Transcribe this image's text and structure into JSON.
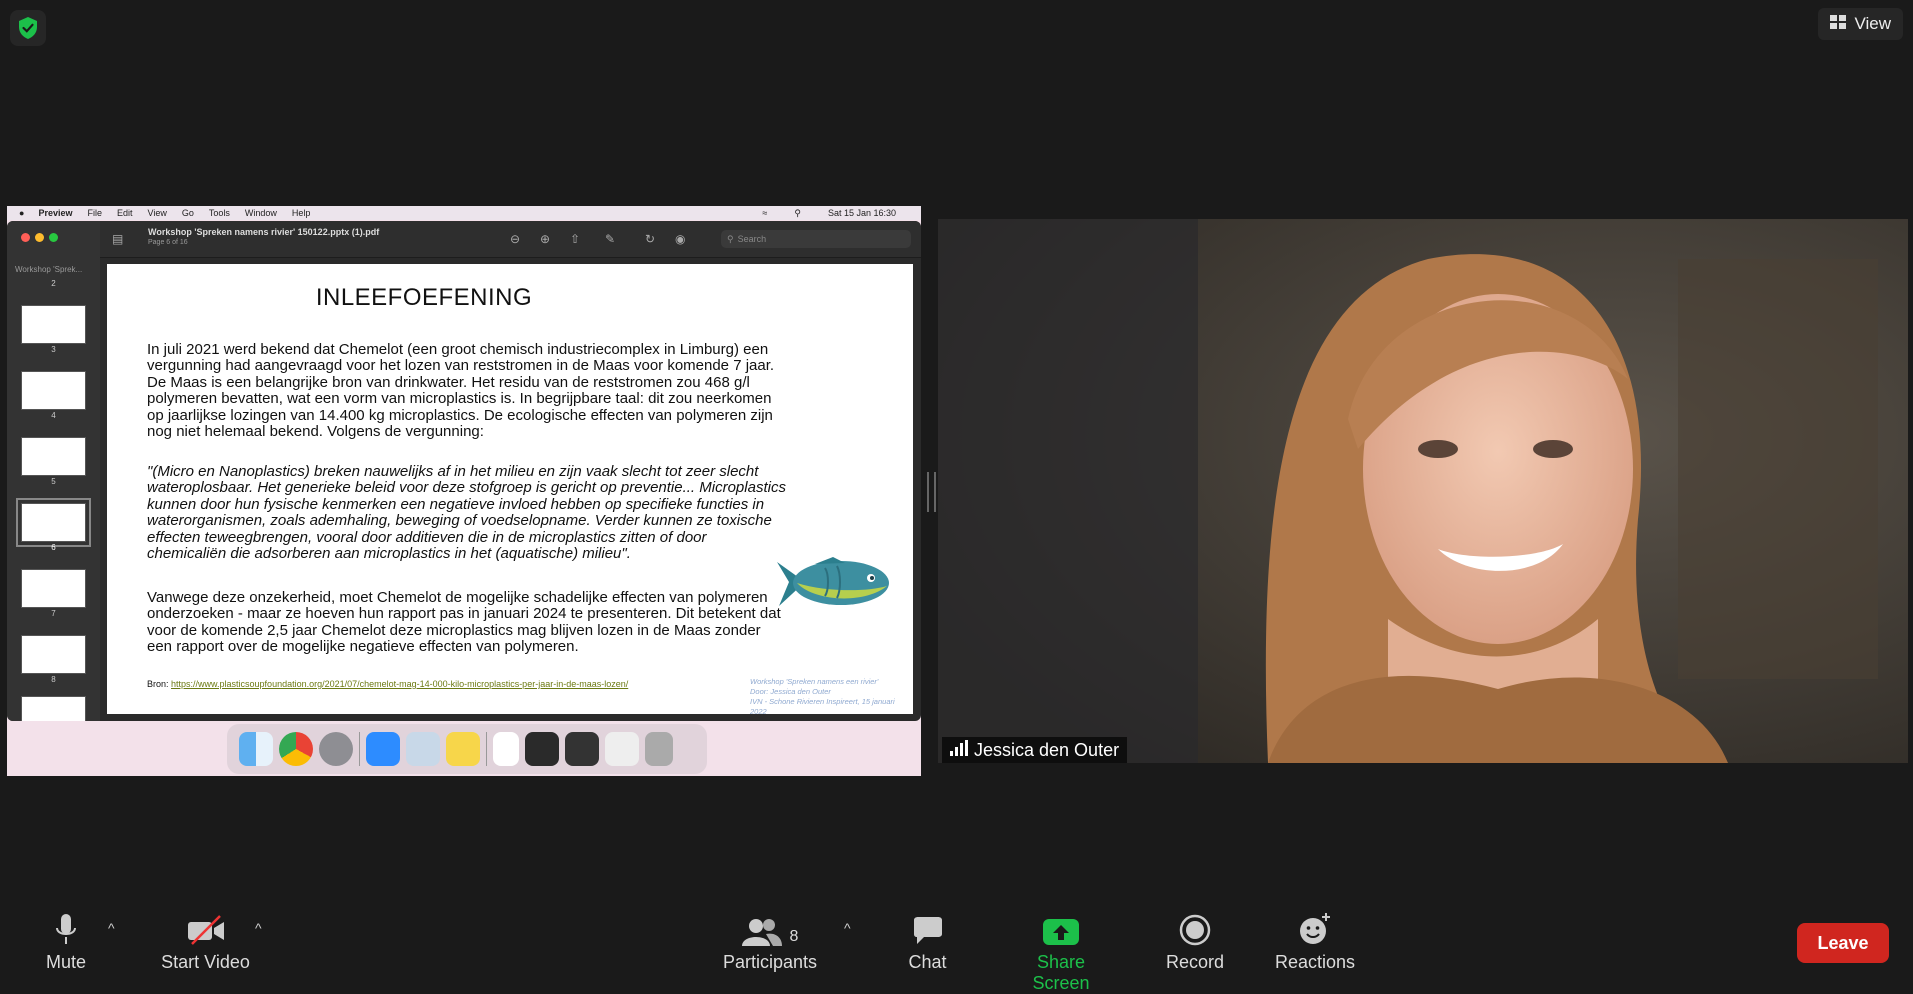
{
  "view_label": "View",
  "mac_menu": {
    "items": [
      "Preview",
      "File",
      "Edit",
      "View",
      "Go",
      "Tools",
      "Window",
      "Help"
    ],
    "clock": "Sat 15 Jan  16:30"
  },
  "preview": {
    "sidebar_title": "Workshop 'Sprek...",
    "doc_title": "Workshop 'Spreken namens rivier' 150122.pptx (1).pdf",
    "page_info": "Page 6 of 16",
    "search_placeholder": "Search",
    "thumb_numbers": [
      "2",
      "3",
      "4",
      "5",
      "6",
      "7",
      "8"
    ]
  },
  "slide": {
    "title": "INLEEFOEFENING",
    "para1": "In juli 2021 werd bekend dat Chemelot (een groot chemisch industriecomplex in Limburg) een vergunning had aangevraagd voor het lozen van reststromen in de Maas voor komende 7 jaar. De Maas is een belangrijke bron van drinkwater. Het residu van de reststromen zou 468 g/l polymeren bevatten, wat een vorm van microplastics is. In begrijpbare taal: dit zou neerkomen op jaarlijkse lozingen van 14.400 kg microplastics. De ecologische effecten van polymeren zijn nog niet helemaal bekend. Volgens de vergunning:",
    "quote": " \"(Micro en Nanoplastics) breken nauwelijks af in het milieu en zijn vaak slecht tot zeer slecht wateroplosbaar. Het generieke beleid voor deze stofgroep is gericht op preventie... Microplastics kunnen door hun fysische kenmerken een negatieve invloed hebben op specifieke functies in waterorganismen, zoals ademhaling, beweging of voedselopname. Verder kunnen ze toxische effecten teweegbrengen, vooral door additieven die in de microplastics zitten of door chemicaliën die adsorberen aan microplastics in het (aquatische) milieu\".",
    "para2": "Vanwege deze onzekerheid, moet Chemelot de mogelijke schadelijke effecten van polymeren onderzoeken - maar ze hoeven hun rapport pas in januari 2024 te presenteren. Dit betekent dat voor de komende 2,5 jaar Chemelot deze microplastics mag blijven lozen in de Maas zonder een rapport over de mogelijke negatieve effecten van polymeren.",
    "bron_label": "Bron: ",
    "bron_link": "https://www.plasticsoupfoundation.org/2021/07/chemelot-mag-14-000-kilo-microplastics-per-jaar-in-de-maas-lozen/",
    "footer_line1": "Workshop 'Spreken namens een rivier'",
    "footer_line2": "Door: Jessica den Outer",
    "footer_line3": "IVN - Schone Rivieren Inspireert, 15 januari 2022"
  },
  "participant_name": "Jessica den Outer",
  "toolbar": {
    "mute": "Mute",
    "start_video": "Start Video",
    "participants": "Participants",
    "participant_count": "8",
    "chat": "Chat",
    "share_screen": "Share Screen",
    "record": "Record",
    "reactions": "Reactions",
    "leave": "Leave"
  },
  "colors": {
    "accent_green": "#1cc04a",
    "leave_red": "#d0261f",
    "background": "#1a1a1a"
  }
}
